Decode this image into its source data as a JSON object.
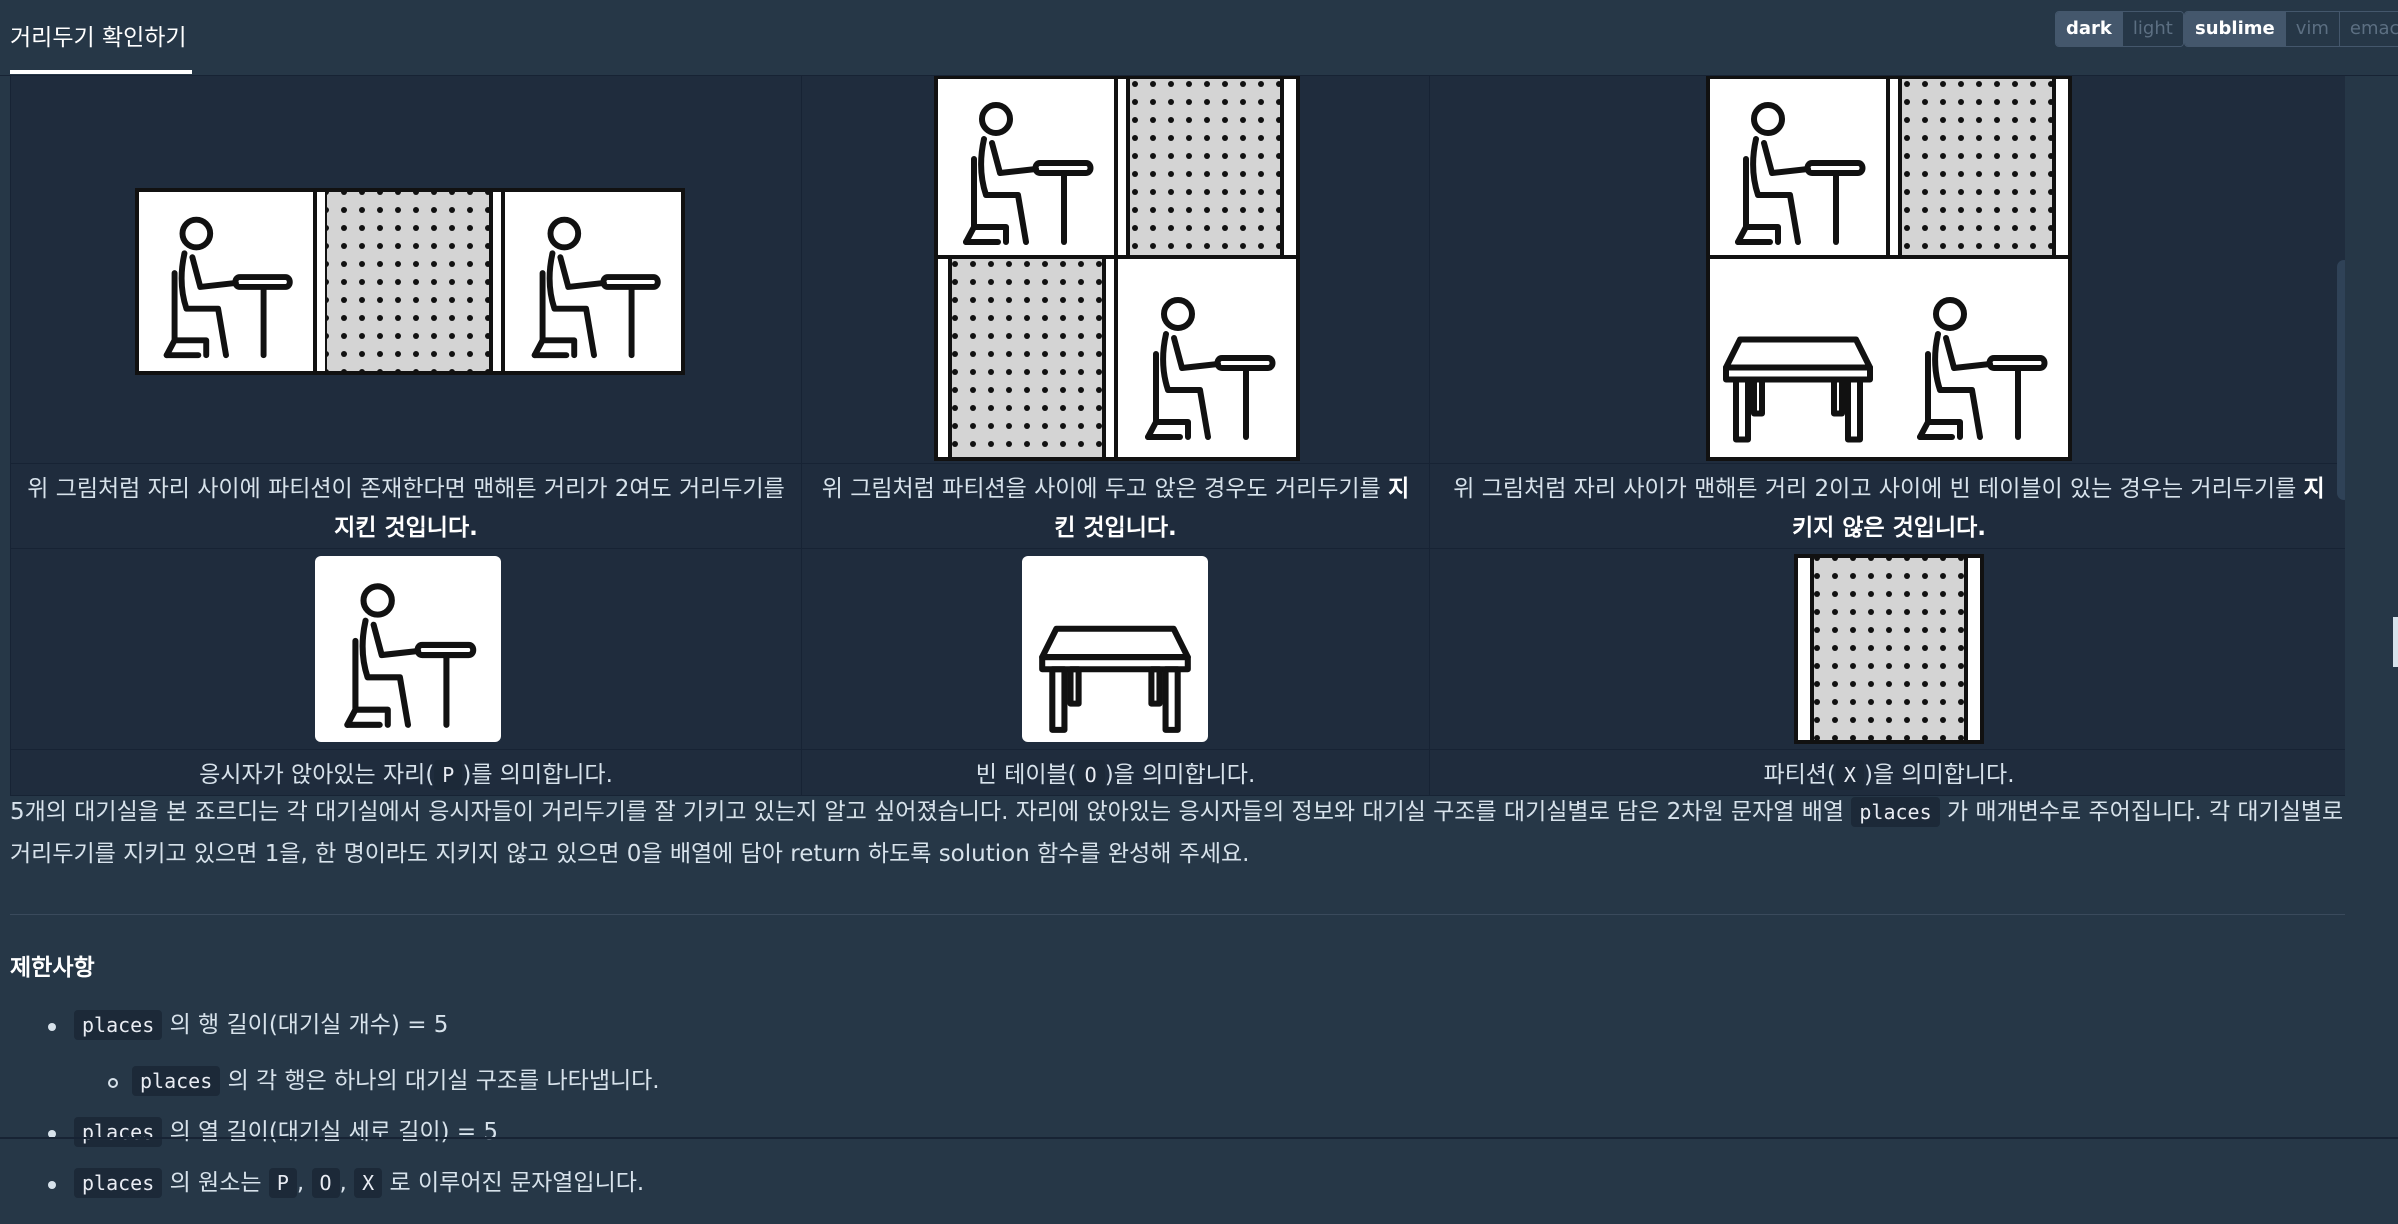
{
  "header": {
    "tab_title": "거리두기 확인하기",
    "theme_buttons": [
      "dark",
      "light"
    ],
    "keymap_buttons": [
      "sublime",
      "vim",
      "emacs"
    ]
  },
  "captions": {
    "c1_text": "위 그림처럼 자리 사이에 파티션이 존재한다면 맨해튼 거리가 2여도 거리두기를 ",
    "c1_bold": "지킨 것입니다.",
    "c2_text": "위 그림처럼 파티션을 사이에 두고 앉은 경우도 거리두기를 ",
    "c2_bold": "지킨 것입니다.",
    "c3_text": "위 그림처럼 자리 사이가 맨해튼 거리 2이고 사이에 빈 테이블이 있는 경우는 거리두기를 ",
    "c3_bold": "지키지 않은 것입니다.",
    "legend_p_pre": "응시자가 앉아있는 자리(",
    "legend_p_code": "P",
    "legend_p_post": ")를 의미합니다.",
    "legend_o_pre": "빈 테이블(",
    "legend_o_code": "O",
    "legend_o_post": ")을 의미합니다.",
    "legend_x_pre": "파티션(",
    "legend_x_code": "X",
    "legend_x_post": ")을 의미합니다."
  },
  "description": {
    "part1": "5개의 대기실을 본 죠르디는 각 대기실에서 응시자들이 거리두기를 잘 기키고 있는지 알고 싶어졌습니다. 자리에 앉아있는 응시자들의 정보와 대기실 구조를 대기실별로 담은 2차원 문자열 배열 ",
    "code": "places",
    "part2": "가 매개변수로 주어집니다. 각 대기실별로 거리두기를 지키고 있으면 1을, 한 명이라도 지키지 않고 있으면 0을 배열에 담아 return 하도록 solution 함수를 완성해 주세요."
  },
  "constraints": {
    "title": "제한사항",
    "item1_code": "places",
    "item1_text": "의 행 길이(대기실 개수) = 5",
    "item1_sub_code": "places",
    "item1_sub_text": "의 각 행은 하나의 대기실 구조를 나타냅니다.",
    "item2_code": "places",
    "item2_text": "의 열 길이(대기실 세로 길이) = 5",
    "item3_code": "places",
    "item3_text": "의 원소는",
    "item3_c1": "P",
    "item3_c2": "O",
    "item3_c3": "X",
    "item3_tail": "로 이루어진 문자열입니다."
  },
  "colors": {
    "background": "#263747",
    "table_bg": "#1f2c3d",
    "text": "#d7e2eb",
    "code_bg": "#1c2938"
  }
}
